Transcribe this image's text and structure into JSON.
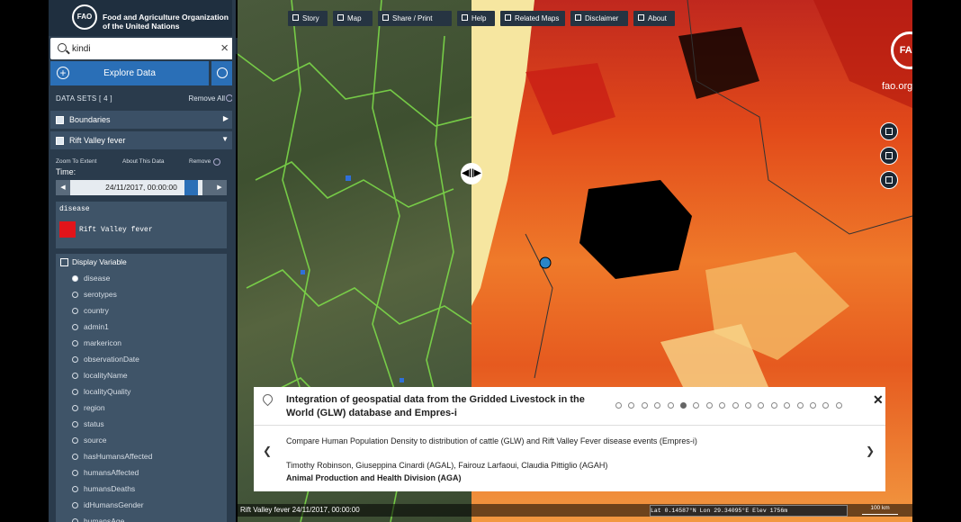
{
  "header": {
    "logo_text": "FAO",
    "org_name": "Food and Agriculture Organization of the United Nations"
  },
  "search": {
    "value": "kindi",
    "clear_icon": "×"
  },
  "explore": {
    "label": "Explore Data"
  },
  "datasets": {
    "label": "DATA SETS [ 4 ]",
    "remove_all": "Remove All"
  },
  "layers": [
    {
      "label": "Boundaries",
      "caret": "▶"
    },
    {
      "label": "Rift Valley fever",
      "caret": "▼"
    }
  ],
  "layer_tools": {
    "zoom": "Zoom To Extent",
    "about": "About This Data",
    "remove": "Remove"
  },
  "time": {
    "label": "Time:",
    "value": "24/11/2017, 00:00:00",
    "prev": "◀",
    "next": "▶"
  },
  "legend": {
    "title": "disease",
    "label": "Rift Valley fever",
    "color": "#e2141a"
  },
  "display_variable": {
    "title": "Display Variable",
    "selected": "disease",
    "options": [
      "disease",
      "serotypes",
      "country",
      "admin1",
      "markericon",
      "observationDate",
      "localityName",
      "localityQuality",
      "region",
      "status",
      "source",
      "hasHumansAffected",
      "humansAffected",
      "humansDeaths",
      "idHumansGender",
      "humansAge"
    ]
  },
  "toolbar": [
    {
      "label": "Story",
      "icon": "story-icon"
    },
    {
      "label": "Map",
      "icon": "map-icon"
    },
    {
      "label": "Share / Print",
      "icon": "share-icon"
    },
    {
      "label": "Help",
      "icon": "help-icon"
    },
    {
      "label": "Related Maps",
      "icon": "grid-icon"
    },
    {
      "label": "Disclaimer",
      "icon": "disclaimer-icon"
    },
    {
      "label": "About",
      "icon": "about-icon"
    }
  ],
  "fao_org": "fao.org",
  "swipe_icon": "◀||▶",
  "story": {
    "title": "Integration of geospatial data from the Gridded Livestock in the World (GLW) database and Empres-i",
    "dots_total": 18,
    "dots_active": 6,
    "close": "✕",
    "prev": "❮",
    "next": "❯",
    "description": "Compare Human Population Density to distribution of cattle (GLW) and Rift Valley Fever disease events (Empres-i)",
    "authors": "Timothy Robinson, Giuseppina Cinardi (AGAL), Fairouz Larfaoui, Claudia Pittiglio (AGAH)",
    "division": "Animal Production and Health Division (AGA)"
  },
  "footer": {
    "layer_status": "Rift Valley fever 24/11/2017, 00:00:00",
    "coords": "Lat  0.14587°N   Lon  29.34095°E   Elev  1756m",
    "scale": "100 km"
  },
  "colors": {
    "sidebar": "#2a3b4c",
    "accent": "#2a6fb7",
    "map_heat": "#e24a1a"
  }
}
